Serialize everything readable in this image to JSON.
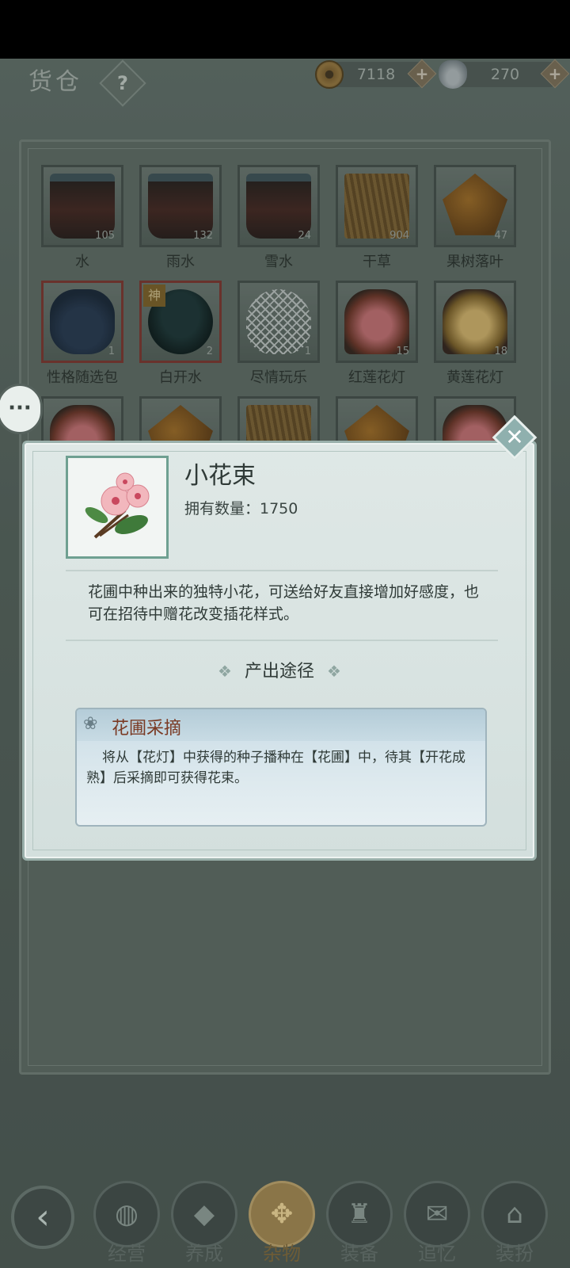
{
  "header": {
    "title": "货仓",
    "help_label": "?",
    "coins": "7118",
    "ingots": "270",
    "plus_label": "+"
  },
  "inventory": [
    {
      "name": "水",
      "qty": "105",
      "pic": "bucket"
    },
    {
      "name": "雨水",
      "qty": "132",
      "pic": "bucket"
    },
    {
      "name": "雪水",
      "qty": "24",
      "pic": "bucket"
    },
    {
      "name": "干草",
      "qty": "904",
      "pic": "straw"
    },
    {
      "name": "果树落叶",
      "qty": "47",
      "pic": "leaf"
    },
    {
      "name": "性格随选包",
      "qty": "1",
      "pic": "bundle",
      "highlight": true
    },
    {
      "name": "白开水",
      "qty": "2",
      "pic": "bowl",
      "highlight": true,
      "badge": "神"
    },
    {
      "name": "尽情玩乐",
      "qty": "1",
      "pic": "net"
    },
    {
      "name": "红莲花灯",
      "qty": "15",
      "pic": "lotus-red"
    },
    {
      "name": "黄莲花灯",
      "qty": "18",
      "pic": "lotus-yellow"
    }
  ],
  "side_chat_label": "···",
  "modal": {
    "item_name": "小花束",
    "quantity_text": "拥有数量：1750",
    "description": "花圃中种出来的独特小花，可送给好友直接增加好感度，也可在招待中赠花改变插花样式。",
    "source_heading": "产出途径",
    "source_ornament": "❖",
    "source": {
      "title": "花圃采摘",
      "text": "将从【花灯】中获得的种子播种在【花圃】中，待其【开花成熟】后采摘即可获得花束。"
    },
    "close_label": "✕"
  },
  "nav": {
    "back_label": "‹",
    "items": [
      {
        "label": "经营",
        "glyph": "◍"
      },
      {
        "label": "养成",
        "glyph": "◆"
      },
      {
        "label": "杂物",
        "glyph": "✥",
        "active": true
      },
      {
        "label": "装备",
        "glyph": "♜"
      },
      {
        "label": "追忆",
        "glyph": "✉"
      },
      {
        "label": "装扮",
        "glyph": "⌂"
      }
    ]
  }
}
